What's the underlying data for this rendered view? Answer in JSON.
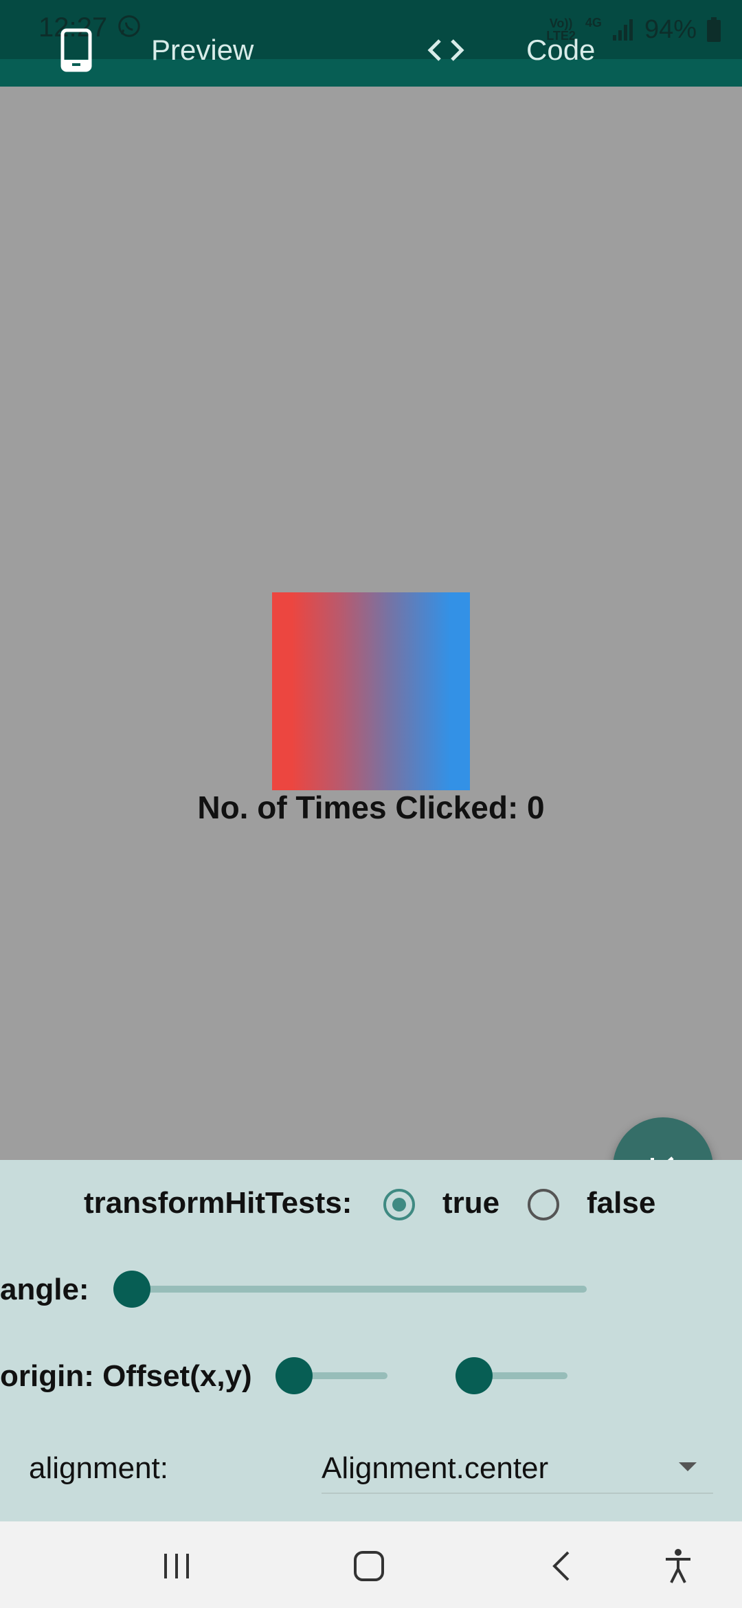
{
  "status": {
    "time": "12:27",
    "network_top": "Vo))",
    "network_bottom": "LTE2",
    "network_gen": "4G",
    "battery": "94%"
  },
  "tabs": {
    "preview_label": "Preview",
    "code_label": "Code"
  },
  "preview": {
    "click_text": "No. of Times Clicked: 0",
    "gradient_colors": [
      "#ec4640",
      "#3391e6"
    ]
  },
  "controls": {
    "transform_label": "transformHitTests:",
    "option_true": "true",
    "option_false": "false",
    "selected": "true",
    "angle_label": "angle:",
    "angle_value": 0,
    "origin_label": "origin: Offset(x,y)",
    "origin_x_value": 0,
    "origin_y_value": 0,
    "alignment_label": "alignment:",
    "alignment_value": "Alignment.center"
  },
  "colors": {
    "accent": "#075e54",
    "status_bar": "#054a42",
    "controls_bg": "#c8dcdb",
    "preview_bg": "#9e9e9e",
    "fab": "#356e68"
  }
}
